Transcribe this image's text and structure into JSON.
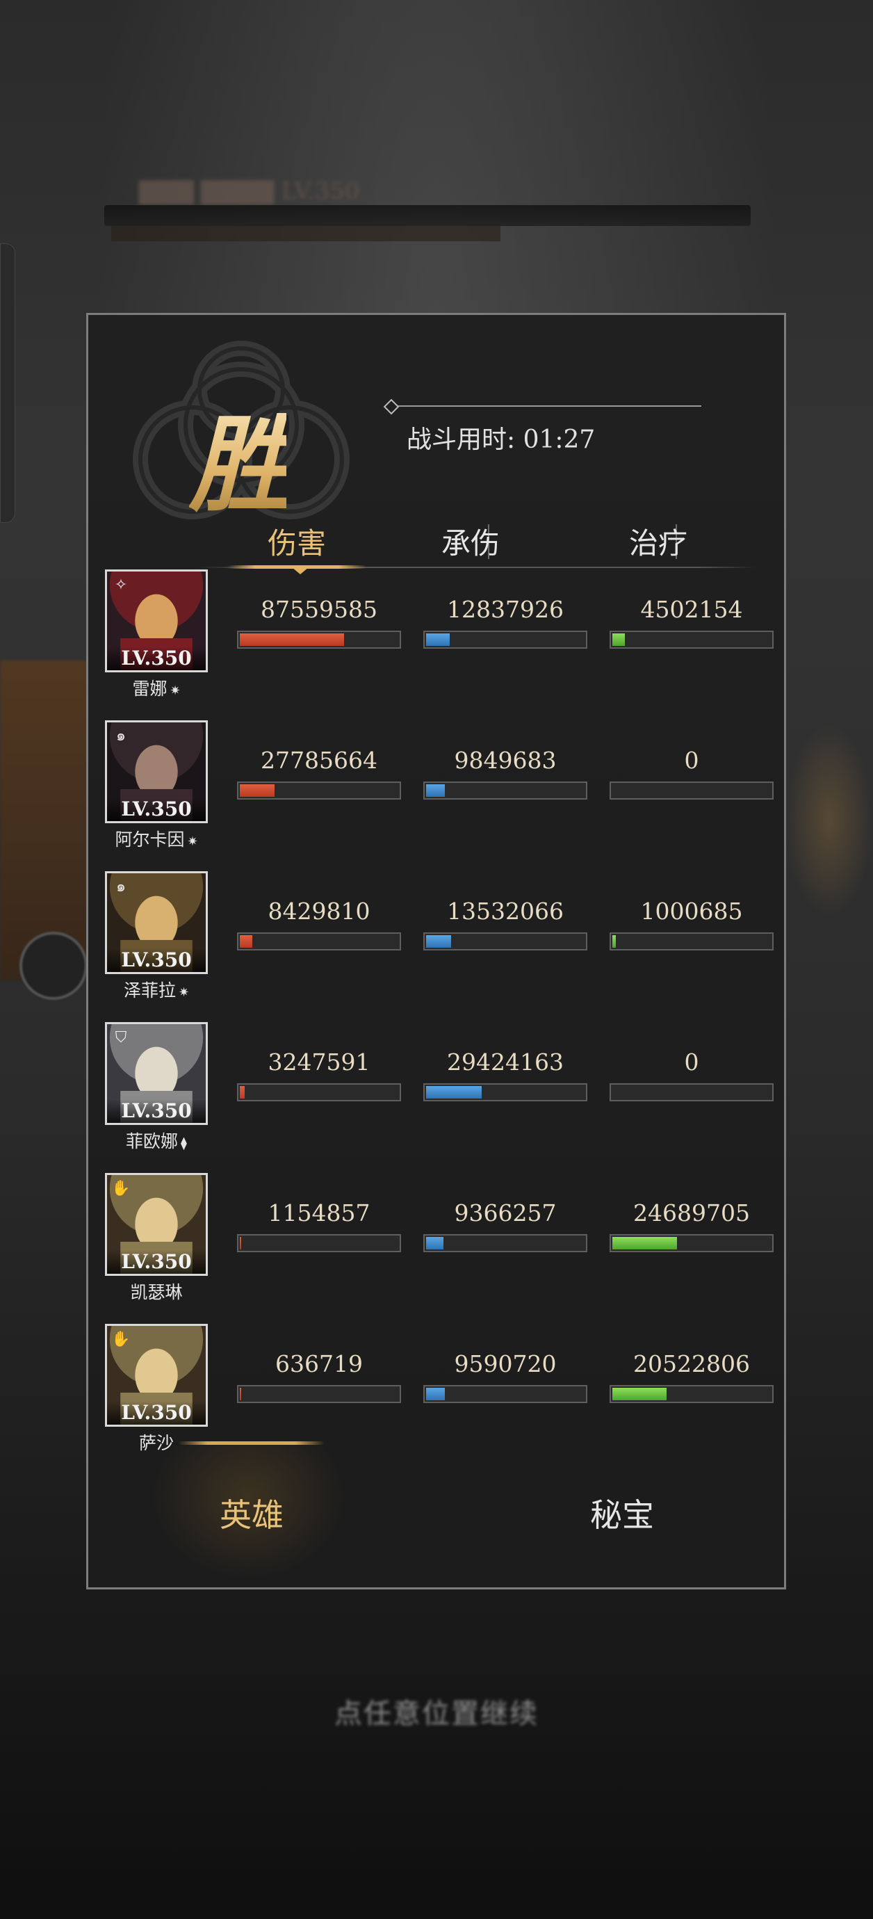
{
  "result": {
    "victory_char": "胜",
    "battle_time": "战斗用时: 01:27"
  },
  "tabs": [
    {
      "label": "伤害",
      "active": true
    },
    {
      "label": "承伤",
      "active": false
    },
    {
      "label": "治疗",
      "active": false
    }
  ],
  "heroes": [
    {
      "name": "雷娜",
      "level": "LV.350",
      "class_icon": "compass-icon",
      "damage": "87559585",
      "taken": "12837926",
      "heal": "4502154",
      "damage_ratio": 0.66,
      "taken_ratio": 0.15,
      "heal_ratio": 0.08
    },
    {
      "name": "阿尔卡因",
      "level": "LV.350",
      "class_icon": "swirl-icon",
      "damage": "27785664",
      "taken": "9849683",
      "heal": "0",
      "damage_ratio": 0.22,
      "taken_ratio": 0.12,
      "heal_ratio": 0.0
    },
    {
      "name": "泽菲拉",
      "level": "LV.350",
      "class_icon": "swirl-icon",
      "damage": "8429810",
      "taken": "13532066",
      "heal": "1000685",
      "damage_ratio": 0.08,
      "taken_ratio": 0.16,
      "heal_ratio": 0.02
    },
    {
      "name": "菲欧娜",
      "level": "LV.350",
      "class_icon": "shield-icon",
      "damage": "3247591",
      "taken": "29424163",
      "heal": "0",
      "damage_ratio": 0.03,
      "taken_ratio": 0.35,
      "heal_ratio": 0.0
    },
    {
      "name": "凯瑟琳",
      "level": "LV.350",
      "class_icon": "hand-icon",
      "damage": "1154857",
      "taken": "9366257",
      "heal": "24689705",
      "damage_ratio": 0.01,
      "taken_ratio": 0.11,
      "heal_ratio": 0.41
    },
    {
      "name": "萨沙",
      "level": "LV.350",
      "class_icon": "hand-icon",
      "damage": "636719",
      "taken": "9590720",
      "heal": "20522806",
      "damage_ratio": 0.01,
      "taken_ratio": 0.12,
      "heal_ratio": 0.34
    }
  ],
  "bottom_tabs": [
    {
      "label": "英雄",
      "active": true
    },
    {
      "label": "秘宝",
      "active": false
    }
  ],
  "continue_hint": "点任意位置继续",
  "colors": {
    "gold": "#e8c278",
    "damage": "#d04a2e",
    "taken": "#3f8ccc",
    "heal": "#6cc23f"
  }
}
